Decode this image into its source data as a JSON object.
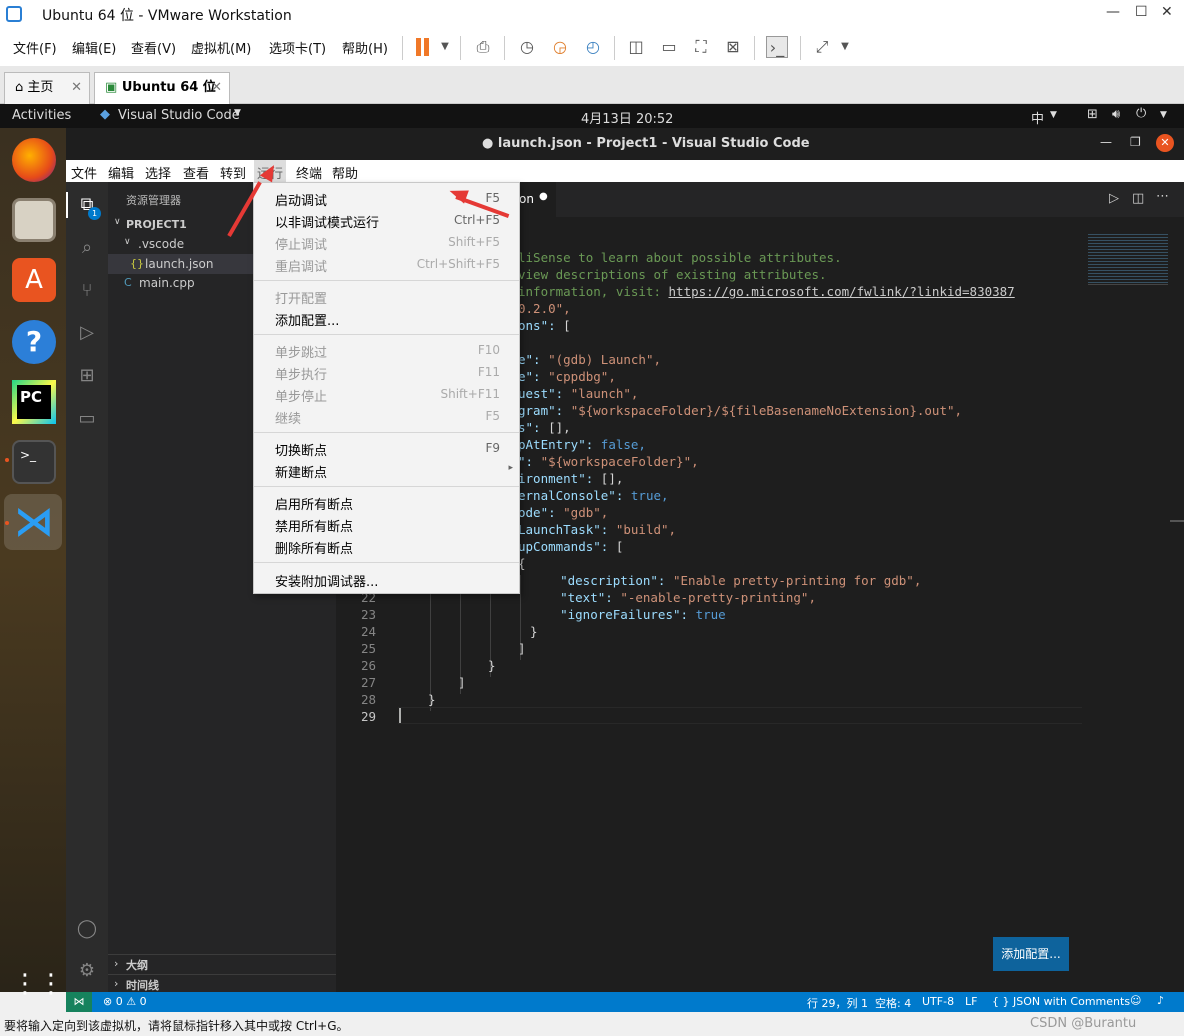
{
  "vm": {
    "window_title": "Ubuntu 64 位 - VMware Workstation",
    "menu": [
      "文件(F)",
      "编辑(E)",
      "查看(V)",
      "虚拟机(M)",
      "选项卡(T)",
      "帮助(H)"
    ],
    "tabs": [
      {
        "label": "主页"
      },
      {
        "label": "Ubuntu 64 位"
      }
    ],
    "status_text": "要将输入定向到该虚拟机，请将鼠标指针移入其中或按 Ctrl+G。",
    "watermark": "CSDN @Burantu"
  },
  "gnome": {
    "activities": "Activities",
    "app_name": "Visual Studio Code",
    "clock": "4月13日  20:52",
    "input_method": "中"
  },
  "dock": {
    "apps": [
      "firefox-icon",
      "files-icon",
      "software-icon",
      "help-icon",
      "pycharm-icon",
      "terminal-icon",
      "vscode-icon",
      "app-grid-icon"
    ]
  },
  "vscode": {
    "title": "● launch.json - Project1 - Visual Studio Code",
    "menu": [
      "文件",
      "编辑",
      "选择",
      "查看",
      "转到",
      "运行",
      "终端",
      "帮助"
    ],
    "explorer": {
      "header": "资源管理器",
      "project": "PROJECT1",
      "folder": ".vscode",
      "file1": "launch.json",
      "file2": "main.cpp",
      "outline": "大纲",
      "timeline": "时间线",
      "badge": "1"
    },
    "tab_label": "on",
    "code_lines": [
      {
        "n": "",
        "t": "liSense to learn about possible attributes."
      },
      {
        "n": "",
        "t": "view descriptions of existing attributes."
      },
      {
        "n": "",
        "t": "information, visit: https://go.microsoft.com/fwlink/?linkid=830387"
      },
      {
        "n": "",
        "t": "0.2.0\","
      },
      {
        "n": "",
        "t": "ons\": ["
      },
      {
        "n": "",
        "t": ""
      },
      {
        "n": "",
        "t": "e\": \"(gdb) Launch\","
      },
      {
        "n": "",
        "t": "e\": \"cppdbg\","
      },
      {
        "n": "",
        "t": "uest\": \"launch\","
      },
      {
        "n": "",
        "t": "gram\": \"${workspaceFolder}/${fileBasenameNoExtension}.out\","
      },
      {
        "n": "",
        "t": "s\": [],"
      },
      {
        "n": "",
        "t": "pAtEntry\": false,"
      },
      {
        "n": "",
        "t": "\": \"${workspaceFolder}\","
      },
      {
        "n": "",
        "t": "ironment\": [],"
      },
      {
        "n": "",
        "t": "ernalConsole\": true,"
      },
      {
        "n": "",
        "t": "ode\": \"gdb\","
      },
      {
        "n": "",
        "t": "LaunchTask\": \"build\","
      },
      {
        "n": "",
        "t": "upCommands\": ["
      },
      {
        "n": "",
        "t": "{"
      },
      {
        "n": "",
        "t": "    \"description\": \"Enable pretty-printing for gdb\","
      },
      {
        "n": "22",
        "t": "    \"text\": \"-enable-pretty-printing\","
      },
      {
        "n": "23",
        "t": "    \"ignoreFailures\": true"
      },
      {
        "n": "24",
        "t": "}"
      },
      {
        "n": "25",
        "t": "]"
      },
      {
        "n": "26",
        "t": "}"
      },
      {
        "n": "27",
        "t": "]"
      },
      {
        "n": "28",
        "t": "}"
      },
      {
        "n": "29",
        "t": ""
      }
    ],
    "add_config_button": "添加配置...",
    "status": {
      "problems": "⊗ 0 ⚠ 0",
      "position": "行 29，列 1",
      "spaces": "空格: 4",
      "encoding": "UTF-8",
      "eol": "LF",
      "language": "{ } JSON with Comments"
    },
    "run_menu": {
      "items": [
        {
          "label": "启动调试",
          "shortcut": "F5",
          "disabled": false
        },
        {
          "label": "以非调试模式运行",
          "shortcut": "Ctrl+F5",
          "disabled": false
        },
        {
          "label": "停止调试",
          "shortcut": "Shift+F5",
          "disabled": true
        },
        {
          "label": "重启调试",
          "shortcut": "Ctrl+Shift+F5",
          "disabled": true
        },
        {
          "label": "打开配置",
          "shortcut": "",
          "disabled": true
        },
        {
          "label": "添加配置...",
          "shortcut": "",
          "disabled": false
        },
        {
          "label": "单步跳过",
          "shortcut": "F10",
          "disabled": true
        },
        {
          "label": "单步执行",
          "shortcut": "F11",
          "disabled": true
        },
        {
          "label": "单步停止",
          "shortcut": "Shift+F11",
          "disabled": true
        },
        {
          "label": "继续",
          "shortcut": "F5",
          "disabled": true
        },
        {
          "label": "切换断点",
          "shortcut": "F9",
          "disabled": false
        },
        {
          "label": "新建断点",
          "shortcut": "▸",
          "disabled": false
        },
        {
          "label": "启用所有断点",
          "shortcut": "",
          "disabled": false
        },
        {
          "label": "禁用所有断点",
          "shortcut": "",
          "disabled": false
        },
        {
          "label": "删除所有断点",
          "shortcut": "",
          "disabled": false
        },
        {
          "label": "安装附加调试器...",
          "shortcut": "",
          "disabled": false
        }
      ]
    }
  },
  "colors": {
    "accent": "#007acc",
    "arrow": "#e53935",
    "key": "#9cdcfe",
    "string": "#ce9178",
    "keyword": "#569cd6",
    "comment": "#6a9955"
  }
}
